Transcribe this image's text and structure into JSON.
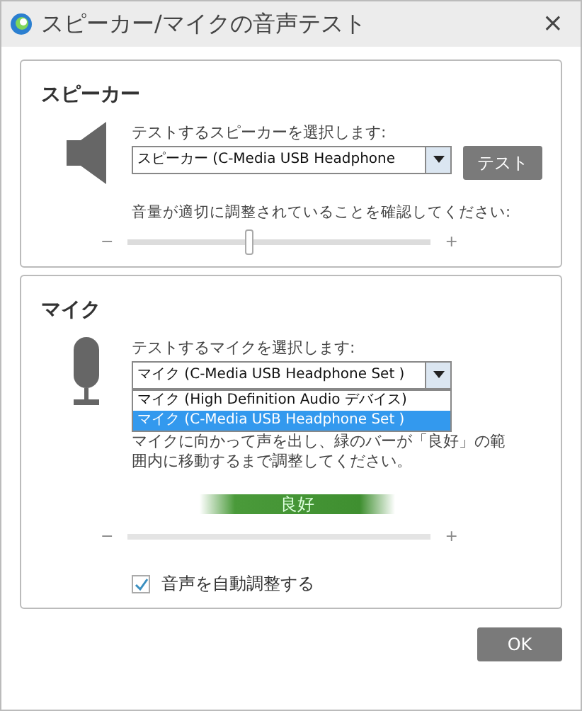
{
  "window": {
    "title": "スピーカー/マイクの音声テスト",
    "close": "×"
  },
  "speaker": {
    "heading": "スピーカー",
    "select_label": "テストするスピーカーを選択します:",
    "select_value": "スピーカー (C-Media USB Headphone",
    "test_button": "テスト",
    "volume_label": "音量が適切に調整されていることを確認してください:",
    "minus": "−",
    "plus": "+",
    "level": 0.4
  },
  "mic": {
    "heading": "マイク",
    "select_label": "テストするマイクを選択します:",
    "select_value": "マイク (C-Media USB Headphone Set )",
    "options": [
      {
        "label": "マイク (High Definition Audio デバイス)",
        "selected": false
      },
      {
        "label": "マイク (C-Media USB Headphone Set )",
        "selected": true
      }
    ],
    "instructions": "マイクに向かって声を出し、緑のバーが「良好」の範囲内に移動するまで調整してください。",
    "meter_label": "良好",
    "minus": "−",
    "plus": "+",
    "auto_adjust": {
      "label": "音声を自動調整する",
      "checked": true
    }
  },
  "buttons": {
    "ok": "OK"
  }
}
